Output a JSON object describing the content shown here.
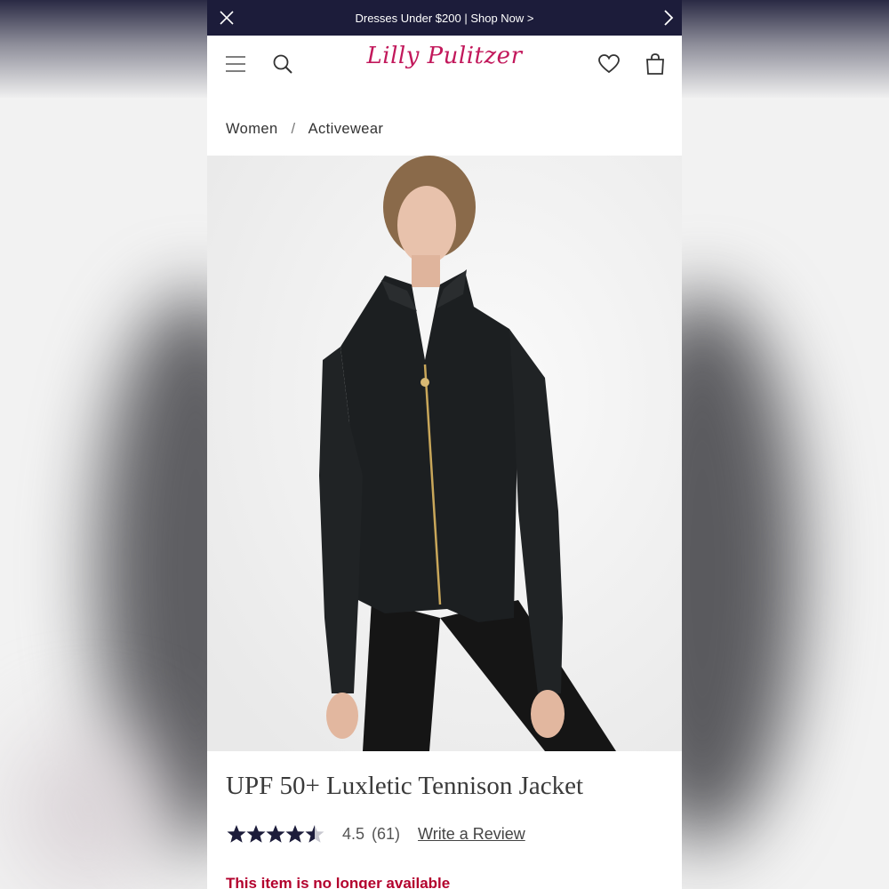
{
  "promo": {
    "text": "Dresses Under $200 | Shop Now >"
  },
  "brand": {
    "logo_text": "Lilly Pulitzer"
  },
  "header": {
    "icons": [
      "menu-icon",
      "search-icon",
      "heart-icon",
      "shopping-bag-icon"
    ]
  },
  "breadcrumb": {
    "items": [
      "Women",
      "Activewear"
    ],
    "separator": "/"
  },
  "product": {
    "title": "UPF 50+ Luxletic Tennison Jacket",
    "rating_value": "4.5",
    "review_count": "(61)",
    "stars": 4.5,
    "write_review": "Write a Review",
    "availability": "This item is no longer available"
  },
  "colors": {
    "promo_bar": "#1c1c3a",
    "logo": "#c2185b",
    "star": "#1c1c3a",
    "unavailable": "#b3002d"
  }
}
